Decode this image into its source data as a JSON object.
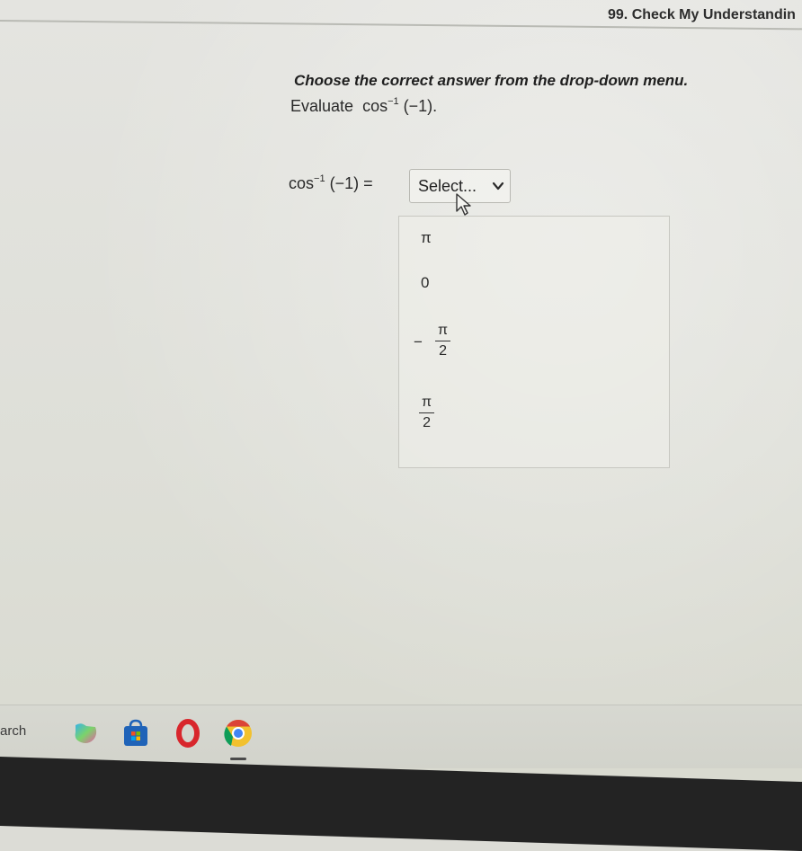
{
  "header": {
    "title": "99. Check My Understandin"
  },
  "question": {
    "instructions": "Choose the correct answer from the drop-down menu.",
    "evaluate_label": "Evaluate",
    "expression_func": "cos",
    "expression_sup": "−1",
    "expression_arg": "(−1).",
    "equation_func": "cos",
    "equation_sup": "−1",
    "equation_rest": "(−1) ="
  },
  "select": {
    "selected_label": "Select...",
    "options": [
      {
        "label": "π"
      },
      {
        "label": "0"
      },
      {
        "sign": "−",
        "numerator": "π",
        "denominator": "2"
      },
      {
        "numerator": "π",
        "denominator": "2"
      }
    ]
  },
  "taskbar": {
    "search_label": "arch",
    "icons": [
      "copilot-icon",
      "microsoft-store-icon",
      "office-icon",
      "chrome-icon"
    ]
  },
  "colors": {
    "background": "#dcdcd6",
    "text": "#2a2a2a",
    "bezel": "#232323"
  }
}
